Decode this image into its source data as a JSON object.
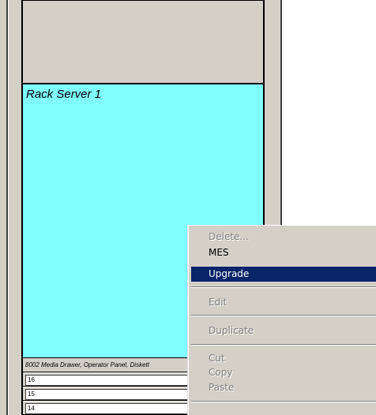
{
  "rack": {
    "server_label": "Rack Server 1",
    "drawer_label": "8002 Media Drawer, Operator Panel, Diskett",
    "units": [
      "16",
      "15",
      "14"
    ]
  },
  "context_menu": {
    "items": [
      {
        "label": "Delete...",
        "state": "disabled"
      },
      {
        "label": "MES",
        "state": "enabled"
      },
      {
        "label": "Upgrade",
        "state": "selected"
      },
      {
        "label": "Edit",
        "state": "disabled"
      },
      {
        "label": "Duplicate",
        "state": "disabled"
      },
      {
        "label": "Cut",
        "state": "disabled"
      },
      {
        "label": "Copy",
        "state": "disabled"
      },
      {
        "label": "Paste",
        "state": "disabled"
      }
    ]
  },
  "colors": {
    "server_fill": "#80ffff",
    "frame": "#d4d0c8",
    "highlight": "#0a246a"
  }
}
